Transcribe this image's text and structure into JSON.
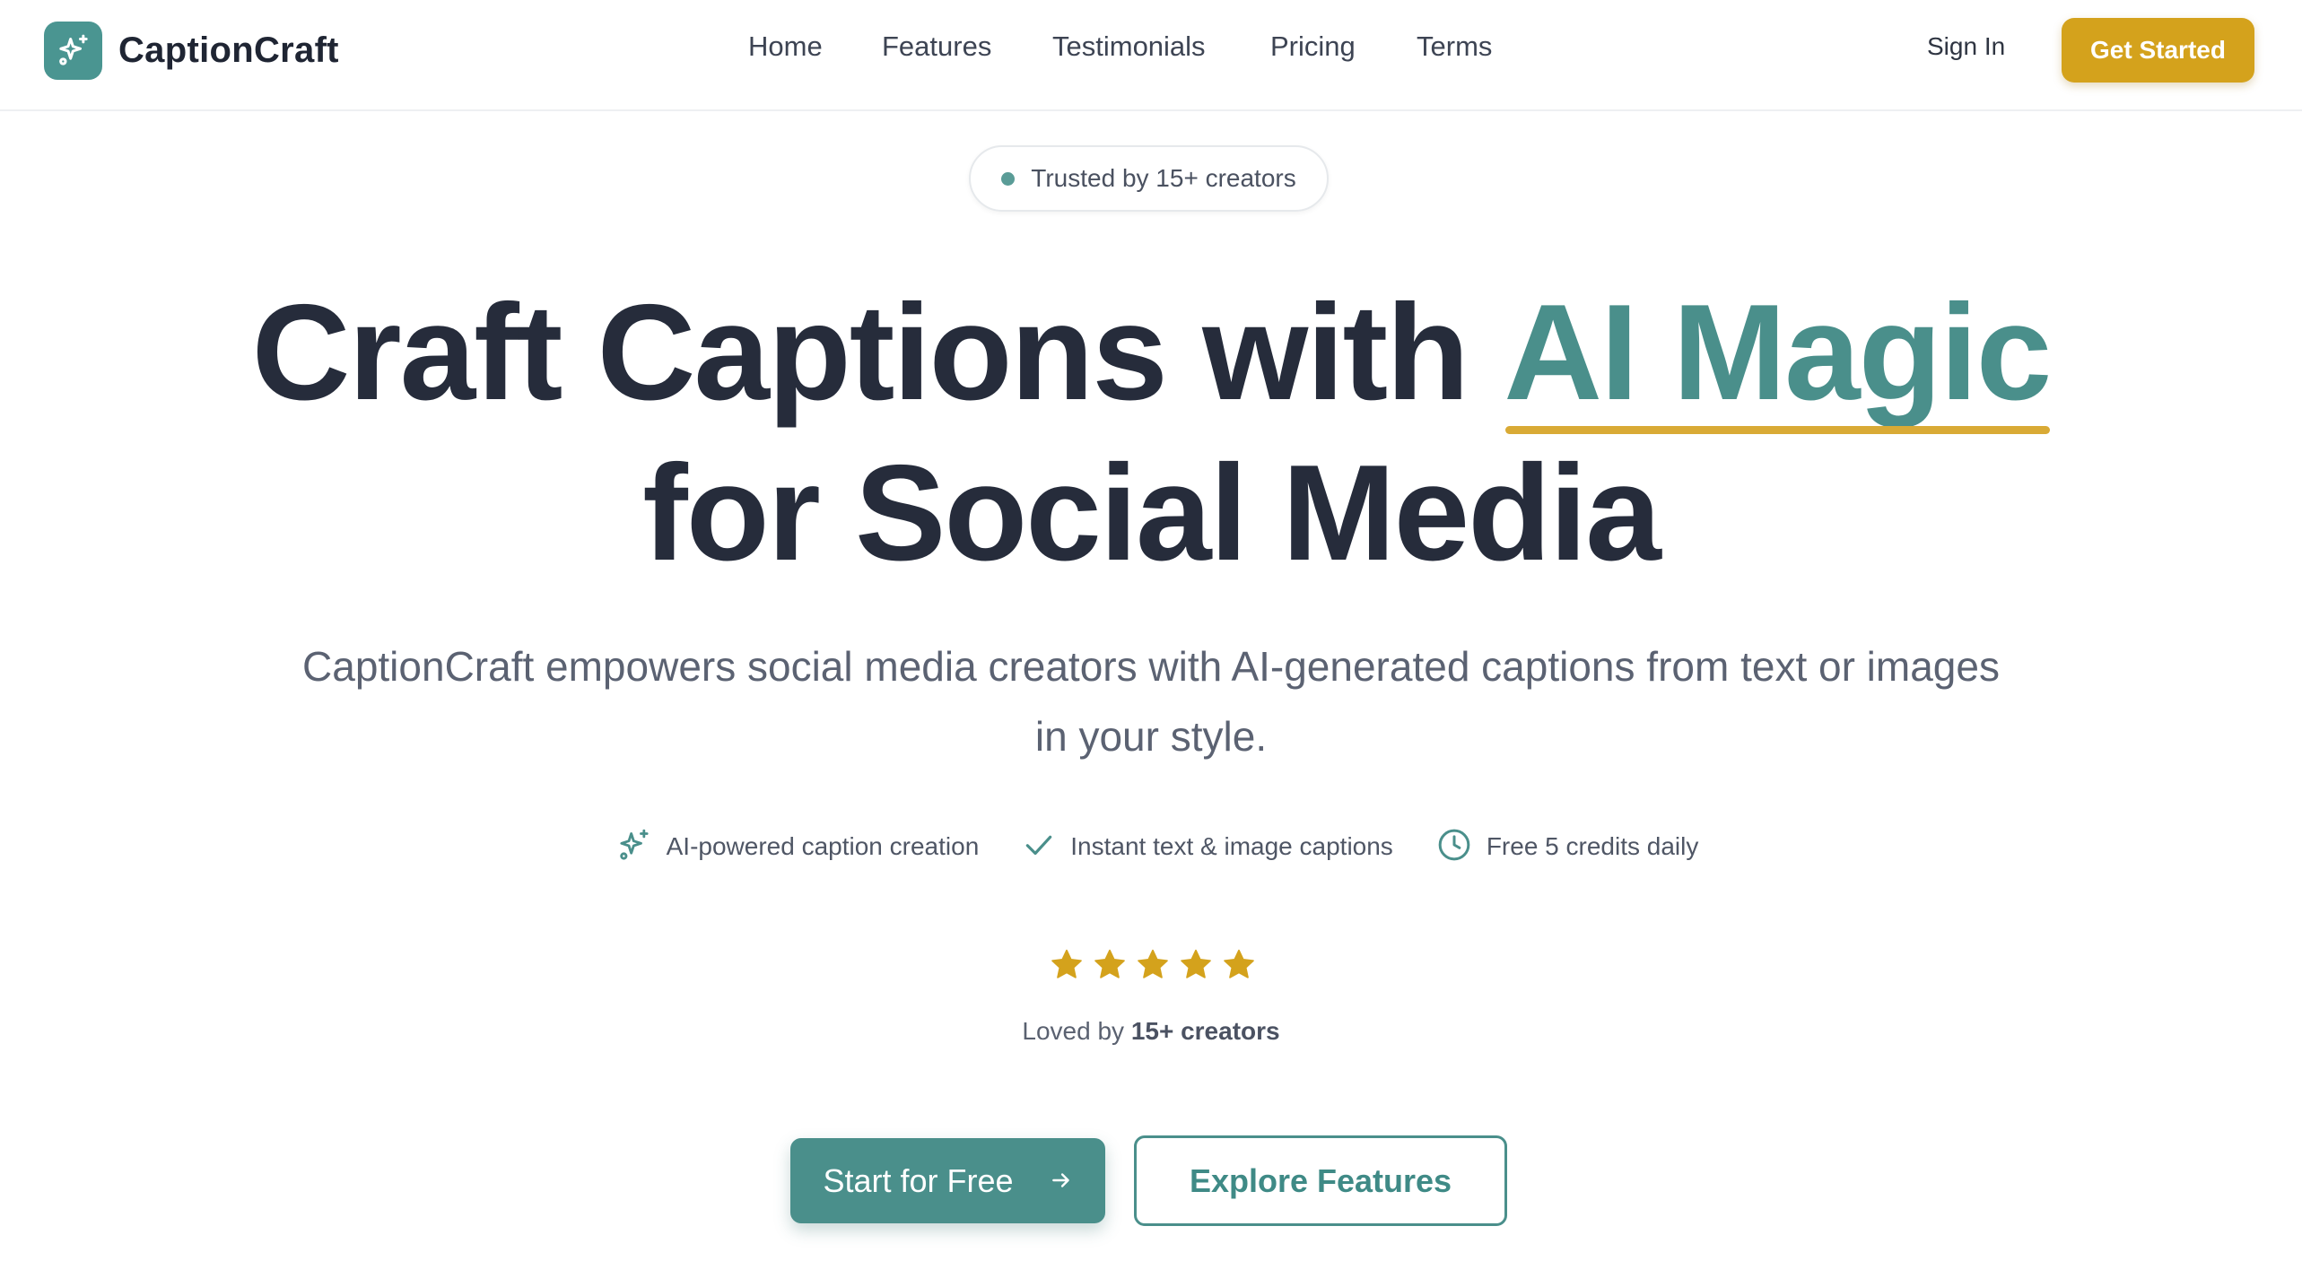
{
  "brand": {
    "name": "CaptionCraft",
    "logo_icon": "sparkles-icon"
  },
  "nav": {
    "items": [
      {
        "label": "Home"
      },
      {
        "label": "Features"
      },
      {
        "label": "Testimonials"
      },
      {
        "label": "Pricing"
      },
      {
        "label": "Terms"
      }
    ],
    "sign_in": "Sign In",
    "get_started": "Get Started"
  },
  "hero": {
    "trust_badge": "Trusted by 15+ creators",
    "headline_part1": "Craft Captions with ",
    "headline_accent": "AI Magic",
    "headline_line2": "for Social Media",
    "subheadline": "CaptionCraft empowers social media creators with AI-generated captions from text or images in your style.",
    "features": [
      {
        "icon": "sparkles-icon",
        "label": "AI-powered caption creation"
      },
      {
        "icon": "check-icon",
        "label": "Instant text & image captions"
      },
      {
        "icon": "clock-icon",
        "label": "Free 5 credits daily"
      }
    ],
    "rating": {
      "stars": 5,
      "max": 5
    },
    "loved_prefix": "Loved by ",
    "loved_count": "15+ creators",
    "cta_primary": "Start for Free",
    "cta_secondary": "Explore Features"
  },
  "colors": {
    "primary": "#4a8f8b",
    "accent": "#d4a21c",
    "heading": "#262c3b",
    "body_text": "#5b6272"
  }
}
